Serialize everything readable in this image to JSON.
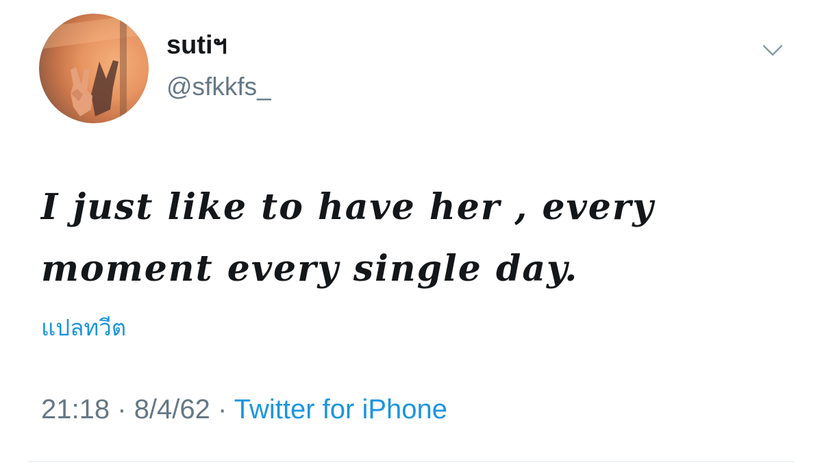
{
  "tweet": {
    "display_name": "sutiฯ",
    "handle": "@sfkkfs_",
    "text": "I just like to have her , every moment every single day.",
    "translate_label": "แปลทวีต",
    "time": "21:18",
    "date": "8/4/62",
    "separator": "·",
    "source": "Twitter for iPhone",
    "menu_icon": "chevron-down-icon",
    "avatar_icon": "avatar-image"
  },
  "colors": {
    "text_primary": "#14171a",
    "text_secondary": "#657786",
    "link": "#1b95e0",
    "divider": "#e1e8ed"
  }
}
